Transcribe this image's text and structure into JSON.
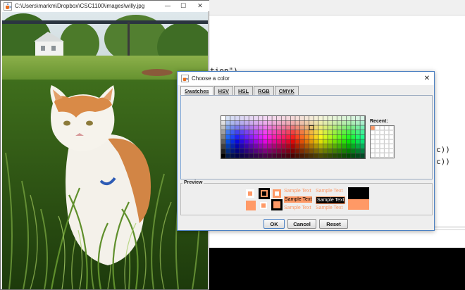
{
  "editor": {
    "code_fragment_1": "tion\")",
    "code_fragment_2": "c))",
    "code_fragment_3": "c))"
  },
  "image_window": {
    "title": "C:\\Users\\markm\\Dropbox\\CSC1100\\images\\willy.jpg",
    "minimize": "—",
    "maximize": "☐",
    "close": "✕",
    "app_icon": "java-cup-icon",
    "photo_description_icon": "cat-in-grass-photo"
  },
  "dialog": {
    "title": "Choose a color",
    "close": "✕",
    "tabs": [
      "Swatches",
      "HSV",
      "HSL",
      "RGB",
      "CMYK"
    ],
    "active_tab": "Swatches",
    "recent_label": "Recent:",
    "preview_label": "Preview",
    "sample_text": "Sample Text",
    "buttons": {
      "ok": "OK",
      "cancel": "Cancel",
      "reset": "Reset"
    },
    "selected_color": "#ff9966",
    "accent": "#4a7fc1"
  }
}
